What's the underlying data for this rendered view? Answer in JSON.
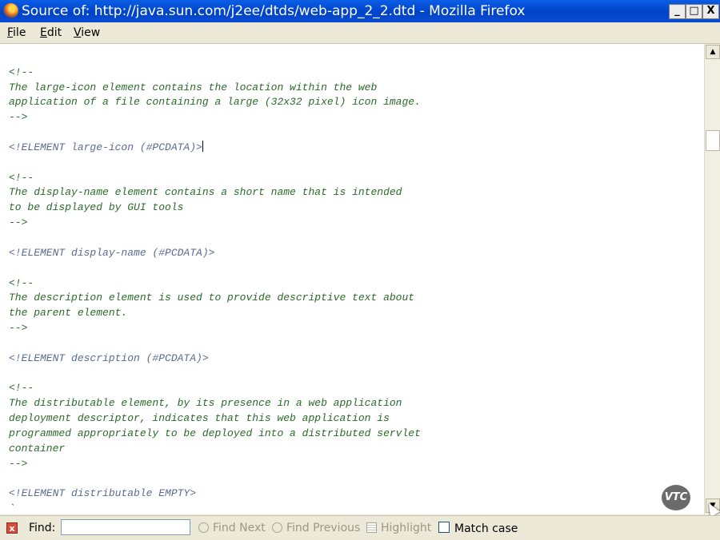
{
  "window": {
    "title": "Source of: http://java.sun.com/j2ee/dtds/web-app_2_2.dtd - Mozilla Firefox",
    "min_glyph": "_",
    "max_glyph": "□",
    "close_glyph": "X"
  },
  "menu": {
    "items": [
      {
        "label": "File",
        "mnemonic": "F",
        "rest": "ile"
      },
      {
        "label": "Edit",
        "mnemonic": "E",
        "rest": "dit"
      },
      {
        "label": "View",
        "mnemonic": "V",
        "rest": "iew"
      }
    ]
  },
  "source": {
    "lines": [
      {
        "text": "                                      ",
        "kind": "comment"
      },
      {
        "text": "",
        "kind": "blank"
      },
      {
        "text": "<!--",
        "kind": "comment"
      },
      {
        "text": "The large-icon element contains the location within the web",
        "kind": "comment"
      },
      {
        "text": "application of a file containing a large (32x32 pixel) icon image.",
        "kind": "comment"
      },
      {
        "text": "-->",
        "kind": "comment"
      },
      {
        "text": "",
        "kind": "blank"
      },
      {
        "text": "<!ELEMENT large-icon (#PCDATA)>",
        "kind": "decl",
        "caret": true
      },
      {
        "text": "",
        "kind": "blank"
      },
      {
        "text": "<!--",
        "kind": "comment"
      },
      {
        "text": "The display-name element contains a short name that is intended",
        "kind": "comment"
      },
      {
        "text": "to be displayed by GUI tools",
        "kind": "comment"
      },
      {
        "text": "-->",
        "kind": "comment"
      },
      {
        "text": "",
        "kind": "blank"
      },
      {
        "text": "<!ELEMENT display-name (#PCDATA)>",
        "kind": "decl"
      },
      {
        "text": "",
        "kind": "blank"
      },
      {
        "text": "<!--",
        "kind": "comment"
      },
      {
        "text": "The description element is used to provide descriptive text about",
        "kind": "comment"
      },
      {
        "text": "the parent element.",
        "kind": "comment"
      },
      {
        "text": "-->",
        "kind": "comment"
      },
      {
        "text": "",
        "kind": "blank"
      },
      {
        "text": "<!ELEMENT description (#PCDATA)>",
        "kind": "decl"
      },
      {
        "text": "",
        "kind": "blank"
      },
      {
        "text": "<!--",
        "kind": "comment"
      },
      {
        "text": "The distributable element, by its presence in a web application",
        "kind": "comment"
      },
      {
        "text": "deployment descriptor, indicates that this web application is",
        "kind": "comment"
      },
      {
        "text": "programmed appropriately to be deployed into a distributed servlet",
        "kind": "comment"
      },
      {
        "text": "container",
        "kind": "comment"
      },
      {
        "text": "-->",
        "kind": "comment"
      },
      {
        "text": "",
        "kind": "blank"
      },
      {
        "text": "<!ELEMENT distributable EMPTY>",
        "kind": "decl"
      },
      {
        "text": "`",
        "kind": "comment"
      }
    ]
  },
  "watermark": {
    "logo_text": "VTC"
  },
  "scrollbar": {
    "up_glyph": "▲",
    "down_glyph": "▼"
  },
  "findbar": {
    "close_glyph": "x",
    "find_label": "Find:",
    "find_value": "",
    "find_next_label": "Find Next",
    "find_previous_label": "Find Previous",
    "highlight_label": "Highlight",
    "match_case_label": "Match case",
    "match_case_checked": false
  },
  "colors": {
    "titlebar": "#0a5ee6",
    "comment_text": "#2a6a2a",
    "declaration_text": "#5a6b93"
  }
}
